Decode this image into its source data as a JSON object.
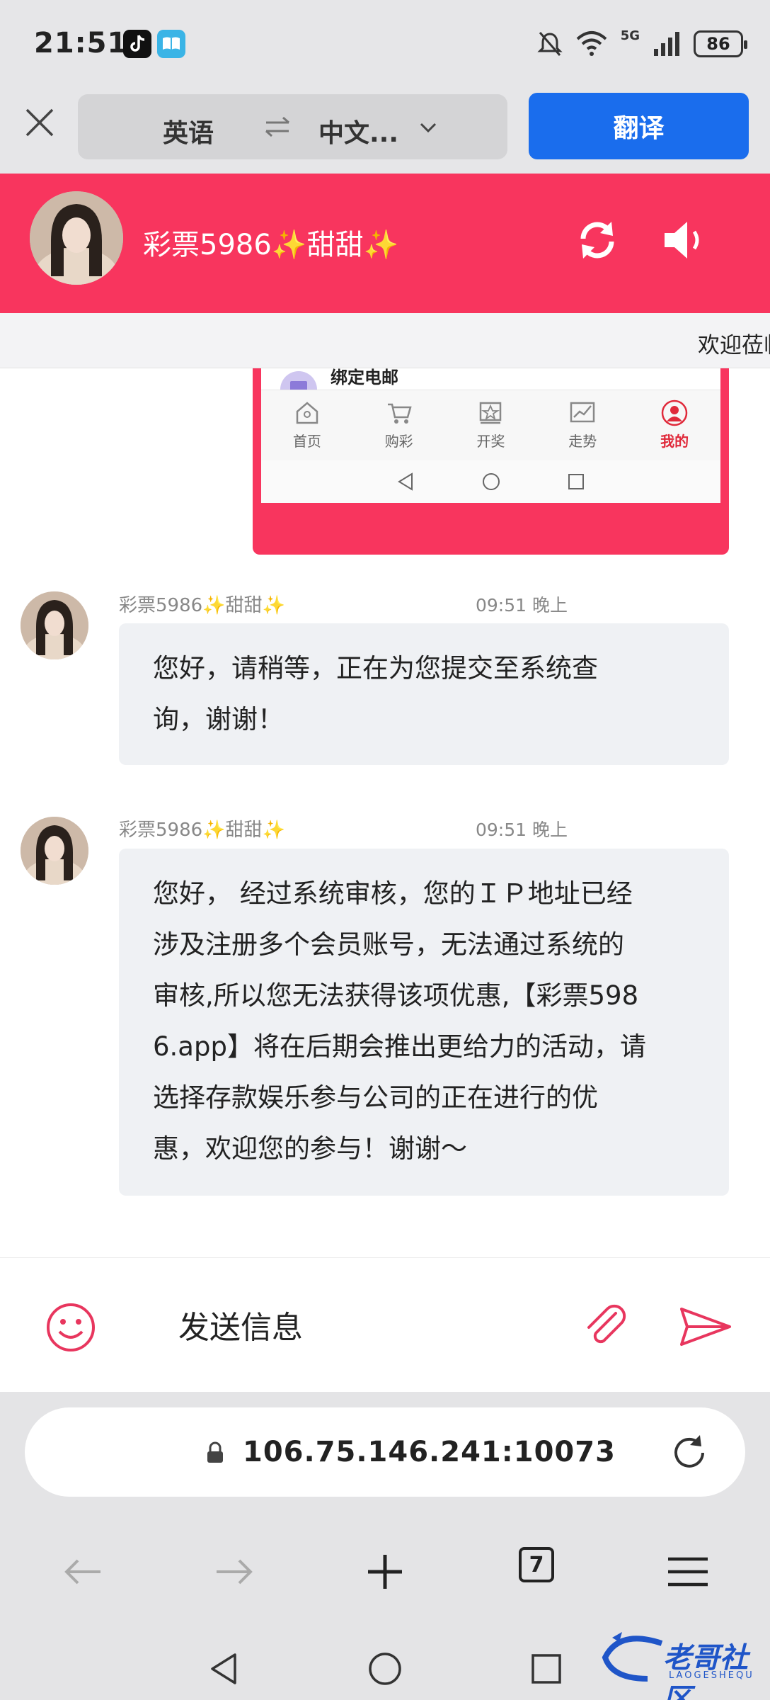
{
  "status_bar": {
    "time": "21:51",
    "battery": "86",
    "network": "5G",
    "icons": [
      "tiktok-icon",
      "book-icon",
      "mute-bell-icon",
      "wifi-icon",
      "signal-icon",
      "battery-icon"
    ]
  },
  "translate_bar": {
    "source_lang": "英语",
    "target_lang": "中文...",
    "translate_button": "翻译"
  },
  "chat_header": {
    "name": "彩票5986✨甜甜✨"
  },
  "marquee": {
    "text": "欢迎莅临"
  },
  "screenshot_card": {
    "bind_email": "绑定电邮",
    "tabs": [
      {
        "label": "首页",
        "icon": "home-icon"
      },
      {
        "label": "购彩",
        "icon": "cart-icon"
      },
      {
        "label": "开奖",
        "icon": "award-icon"
      },
      {
        "label": "走势",
        "icon": "trend-icon"
      },
      {
        "label": "我的",
        "icon": "user-icon",
        "active": true
      }
    ]
  },
  "messages": [
    {
      "sender": "彩票5986✨甜甜✨",
      "time": "09:51 晚上",
      "lines": [
        "您好，请稍等，正在为您提交至系统查",
        "询，谢谢！"
      ]
    },
    {
      "sender": "彩票5986✨甜甜✨",
      "time": "09:51 晚上",
      "lines": [
        "您好，  经过系统审核，您的ＩＰ地址已经",
        "涉及注册多个会员账号，无法通过系统的",
        "审核,所以您无法获得该项优惠,【彩票598",
        "6.app】将在后期会推出更给力的活动，请",
        "选择存款娱乐参与公司的正在进行的优",
        "惠，欢迎您的参与！谢谢～"
      ]
    }
  ],
  "input": {
    "placeholder": "发送信息"
  },
  "browser": {
    "address": "106.75.146.241:10073",
    "tab_count": "7"
  },
  "watermark": {
    "text": "老哥社区",
    "sub": "LAOGESHEQU"
  },
  "colors": {
    "accent": "#f8355e",
    "translate_button": "#1a6ded",
    "bubble": "#eff1f4"
  }
}
